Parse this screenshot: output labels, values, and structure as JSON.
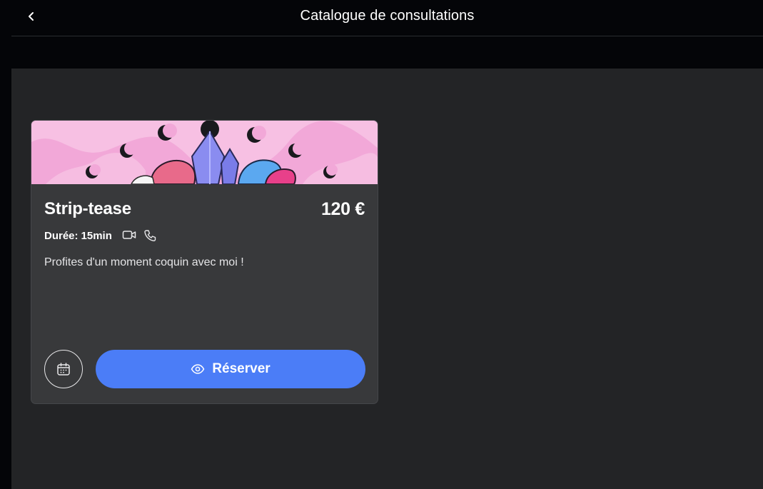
{
  "header": {
    "title": "Catalogue de consultations",
    "back_icon": "chevron-left-icon"
  },
  "card": {
    "title": "Strip-tease",
    "price": "120 €",
    "duration_label": "Durée:",
    "duration_value": "15min",
    "icons": [
      "video-camera-icon",
      "phone-icon"
    ],
    "description": "Profites d'un moment coquin avec moi !",
    "calendar_icon": "calendar-icon",
    "reserve_label": "Réserver",
    "reserve_icon": "eye-icon",
    "banner_color": "#f2a8d8"
  },
  "colors": {
    "background": "#040508",
    "content": "#232426",
    "card": "#38393b",
    "accent": "#4b7df7"
  }
}
